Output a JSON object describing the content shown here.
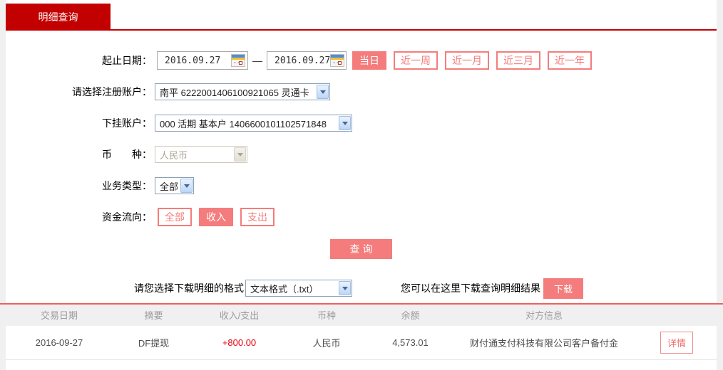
{
  "tab": {
    "label": "明细查询"
  },
  "form": {
    "date_row": {
      "label": "起止日期：",
      "start_date": "2016.09.27",
      "separator": "—",
      "end_date": "2016.09.27",
      "quick_buttons": [
        {
          "label": "当日",
          "active": true
        },
        {
          "label": "近一周",
          "active": false
        },
        {
          "label": "近一月",
          "active": false
        },
        {
          "label": "近三月",
          "active": false
        },
        {
          "label": "近一年",
          "active": false
        }
      ]
    },
    "registered_account": {
      "label": "请选择注册账户：",
      "value": "南平 6222001406100921065 灵通卡"
    },
    "sub_account": {
      "label": "下挂账户：",
      "value": "000 活期 基本户 1406600101102571848"
    },
    "currency": {
      "label": "币　　种：",
      "value": "人民币",
      "disabled": true
    },
    "business_type": {
      "label": "业务类型：",
      "value": "全部"
    },
    "fund_direction": {
      "label": "资金流向：",
      "options": [
        {
          "label": "全部",
          "active": false
        },
        {
          "label": "收入",
          "active": true
        },
        {
          "label": "支出",
          "active": false
        }
      ]
    },
    "query_button_label": "查询"
  },
  "download": {
    "format_label": "请您选择下载明细的格式",
    "format_value": "文本格式（.txt）",
    "hint": "您可以在这里下载查询明细结果",
    "button_label": "下载"
  },
  "table": {
    "headers": [
      "交易日期",
      "摘要",
      "收入/支出",
      "币种",
      "余额",
      "对方信息"
    ],
    "rows": [
      {
        "date": "2016-09-27",
        "summary": "DF提现",
        "amount": "+800.00",
        "currency": "人民币",
        "balance": "4,573.01",
        "counterparty": "财付通支付科技有限公司客户备付金",
        "action_label": "详情"
      }
    ]
  },
  "colors": {
    "brand_red": "#c30000",
    "accent_pink": "#f47c7c",
    "divider_red": "#ee5f5f",
    "amount_red": "#e60012",
    "header_gray": "#9b9b9b"
  }
}
